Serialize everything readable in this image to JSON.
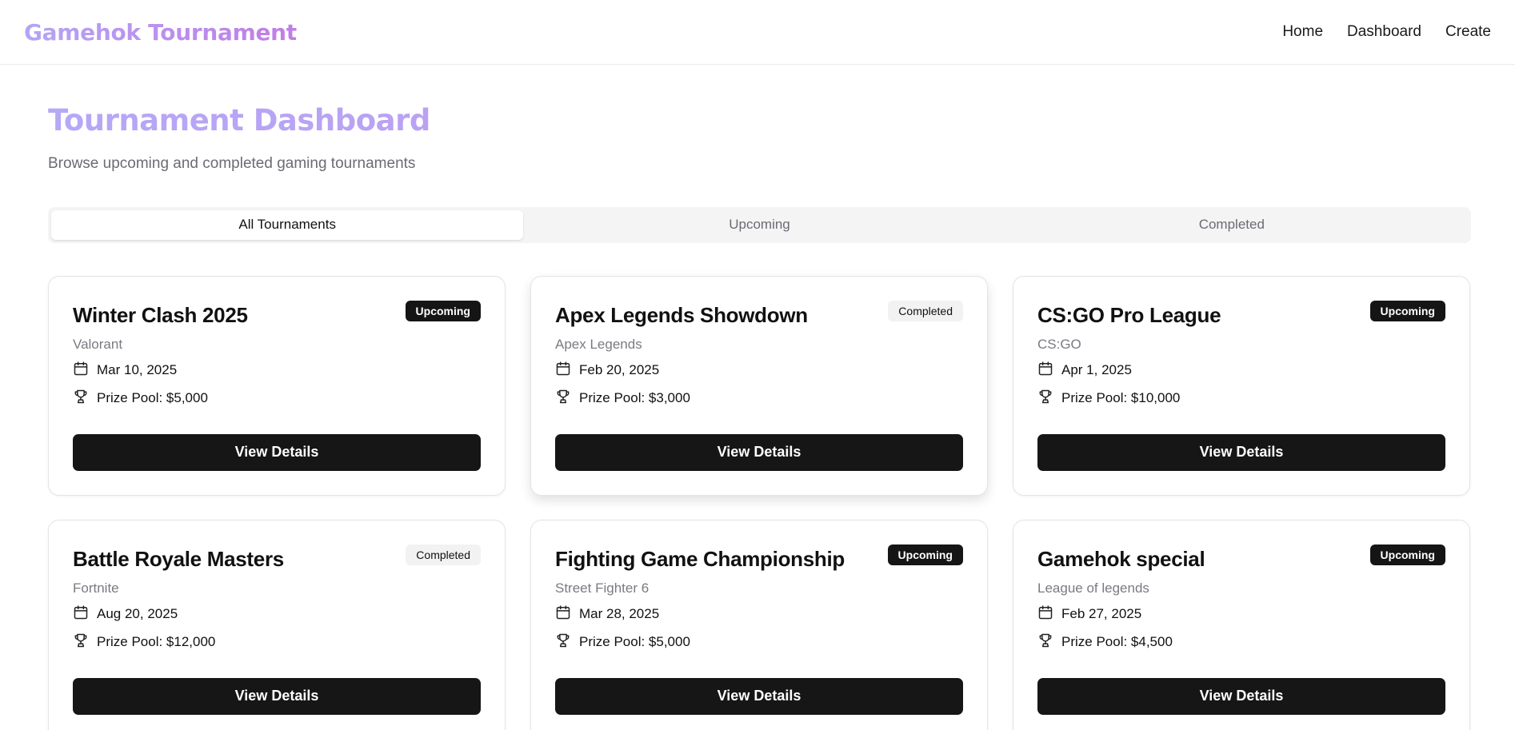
{
  "header": {
    "brand": "Gamehok Tournament",
    "nav": [
      "Home",
      "Dashboard",
      "Create"
    ]
  },
  "page": {
    "title": "Tournament Dashboard",
    "subtitle": "Browse upcoming and completed gaming tournaments"
  },
  "tabs": [
    {
      "label": "All Tournaments",
      "active": true
    },
    {
      "label": "Upcoming",
      "active": false
    },
    {
      "label": "Completed",
      "active": false
    }
  ],
  "icons": {
    "date": "calendar-icon",
    "prize": "trophy-icon"
  },
  "colors": {
    "brand_gradient_start": "#b4a5f5",
    "brand_gradient_end": "#c07de6",
    "button_bg": "#161616"
  },
  "tournaments": [
    {
      "title": "Winter Clash 2025",
      "status": "Upcoming",
      "game": "Valorant",
      "date": "Mar 10, 2025",
      "prize": "Prize Pool: $5,000",
      "button": "View Details"
    },
    {
      "title": "Apex Legends Showdown",
      "status": "Completed",
      "game": "Apex Legends",
      "date": "Feb 20, 2025",
      "prize": "Prize Pool: $3,000",
      "button": "View Details"
    },
    {
      "title": "CS:GO Pro League",
      "status": "Upcoming",
      "game": "CS:GO",
      "date": "Apr 1, 2025",
      "prize": "Prize Pool: $10,000",
      "button": "View Details"
    },
    {
      "title": "Battle Royale Masters",
      "status": "Completed",
      "game": "Fortnite",
      "date": "Aug 20, 2025",
      "prize": "Prize Pool: $12,000",
      "button": "View Details"
    },
    {
      "title": "Fighting Game Championship",
      "status": "Upcoming",
      "game": "Street Fighter 6",
      "date": "Mar 28, 2025",
      "prize": "Prize Pool: $5,000",
      "button": "View Details"
    },
    {
      "title": "Gamehok special",
      "status": "Upcoming",
      "game": "League of legends",
      "date": "Feb 27, 2025",
      "prize": "Prize Pool: $4,500",
      "button": "View Details"
    }
  ]
}
